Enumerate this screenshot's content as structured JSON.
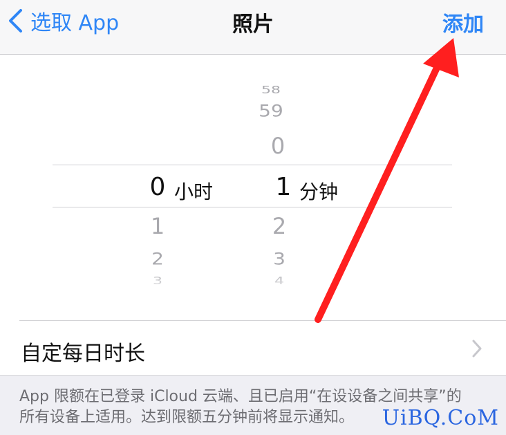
{
  "navbar": {
    "back_label": "选取 App",
    "title": "照片",
    "add_label": "添加"
  },
  "picker": {
    "hours_column": {
      "above": [],
      "selected": "0",
      "below": [
        "1",
        "2",
        "3"
      ],
      "unit": "小时"
    },
    "minutes_column": {
      "above": [
        "58",
        "59",
        "0"
      ],
      "selected": "1",
      "below": [
        "2",
        "3",
        "4"
      ],
      "unit": "分钟"
    }
  },
  "custom_row": {
    "label": "自定每日时长"
  },
  "footer": {
    "note": "App 限额在已登录 iCloud 云端、且已启用“在设设备之间共享”的所有设备上适用。达到限额五分钟前将显示通知。"
  },
  "watermark": {
    "text": "UiBQ.CoM"
  },
  "colors": {
    "accent": "#2f86f6",
    "annotation_arrow": "#ff1f1f",
    "watermark": "#2b66e0"
  }
}
